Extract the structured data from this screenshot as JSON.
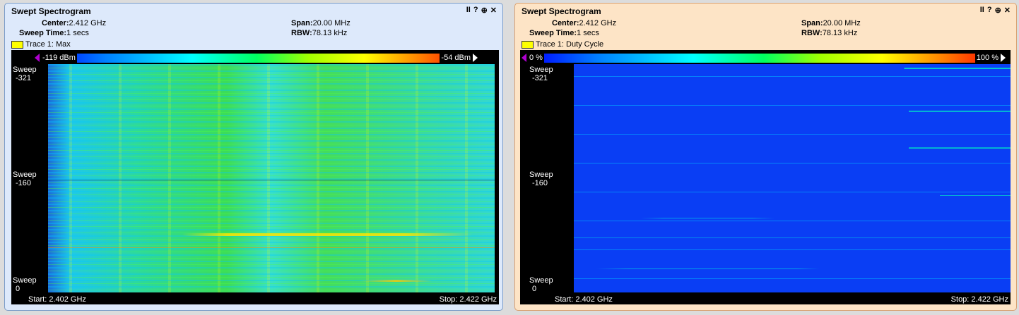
{
  "panels": [
    {
      "title": "Swept Spectrogram",
      "controls": {
        "pause": "II",
        "help": "?",
        "zoom": "⊕",
        "close": "✕"
      },
      "center_label": "Center:",
      "center_value": "2.412 GHz",
      "span_label": "Span:",
      "span_value": "20.00 MHz",
      "sweep_time_label": "Sweep Time:",
      "sweep_time_value": "1 secs",
      "rbw_label": "RBW:",
      "rbw_value": "78.13 kHz",
      "trace_label": "Trace 1: Max",
      "colorbar_min": "-119 dBm",
      "colorbar_max": "-54 dBm",
      "sweep_top": [
        "Sweep",
        "-321"
      ],
      "sweep_mid": [
        "Sweep",
        "-160"
      ],
      "sweep_bot": [
        "Sweep",
        "0"
      ],
      "start": "Start: 2.402 GHz",
      "stop": "Stop: 2.422 GHz"
    },
    {
      "title": "Swept Spectrogram",
      "controls": {
        "pause": "II",
        "help": "?",
        "zoom": "⊕",
        "close": "✕"
      },
      "center_label": "Center:",
      "center_value": "2.412 GHz",
      "span_label": "Span:",
      "span_value": "20.00 MHz",
      "sweep_time_label": "Sweep Time:",
      "sweep_time_value": "1 secs",
      "rbw_label": "RBW:",
      "rbw_value": "78.13 kHz",
      "trace_label": "Trace 1: Duty Cycle",
      "colorbar_min": "0 %",
      "colorbar_max": "100 %",
      "sweep_top": [
        "Sweep",
        "-321"
      ],
      "sweep_mid": [
        "Sweep",
        "-160"
      ],
      "sweep_bot": [
        "Sweep",
        "0"
      ],
      "start": "Start: 2.402 GHz",
      "stop": "Stop: 2.422 GHz"
    }
  ],
  "colors": {
    "trace_swatch": "#ffff00",
    "left_bg": "#dde9fb",
    "right_bg": "#fde4c6",
    "duty_base": "#0a3ef4"
  }
}
